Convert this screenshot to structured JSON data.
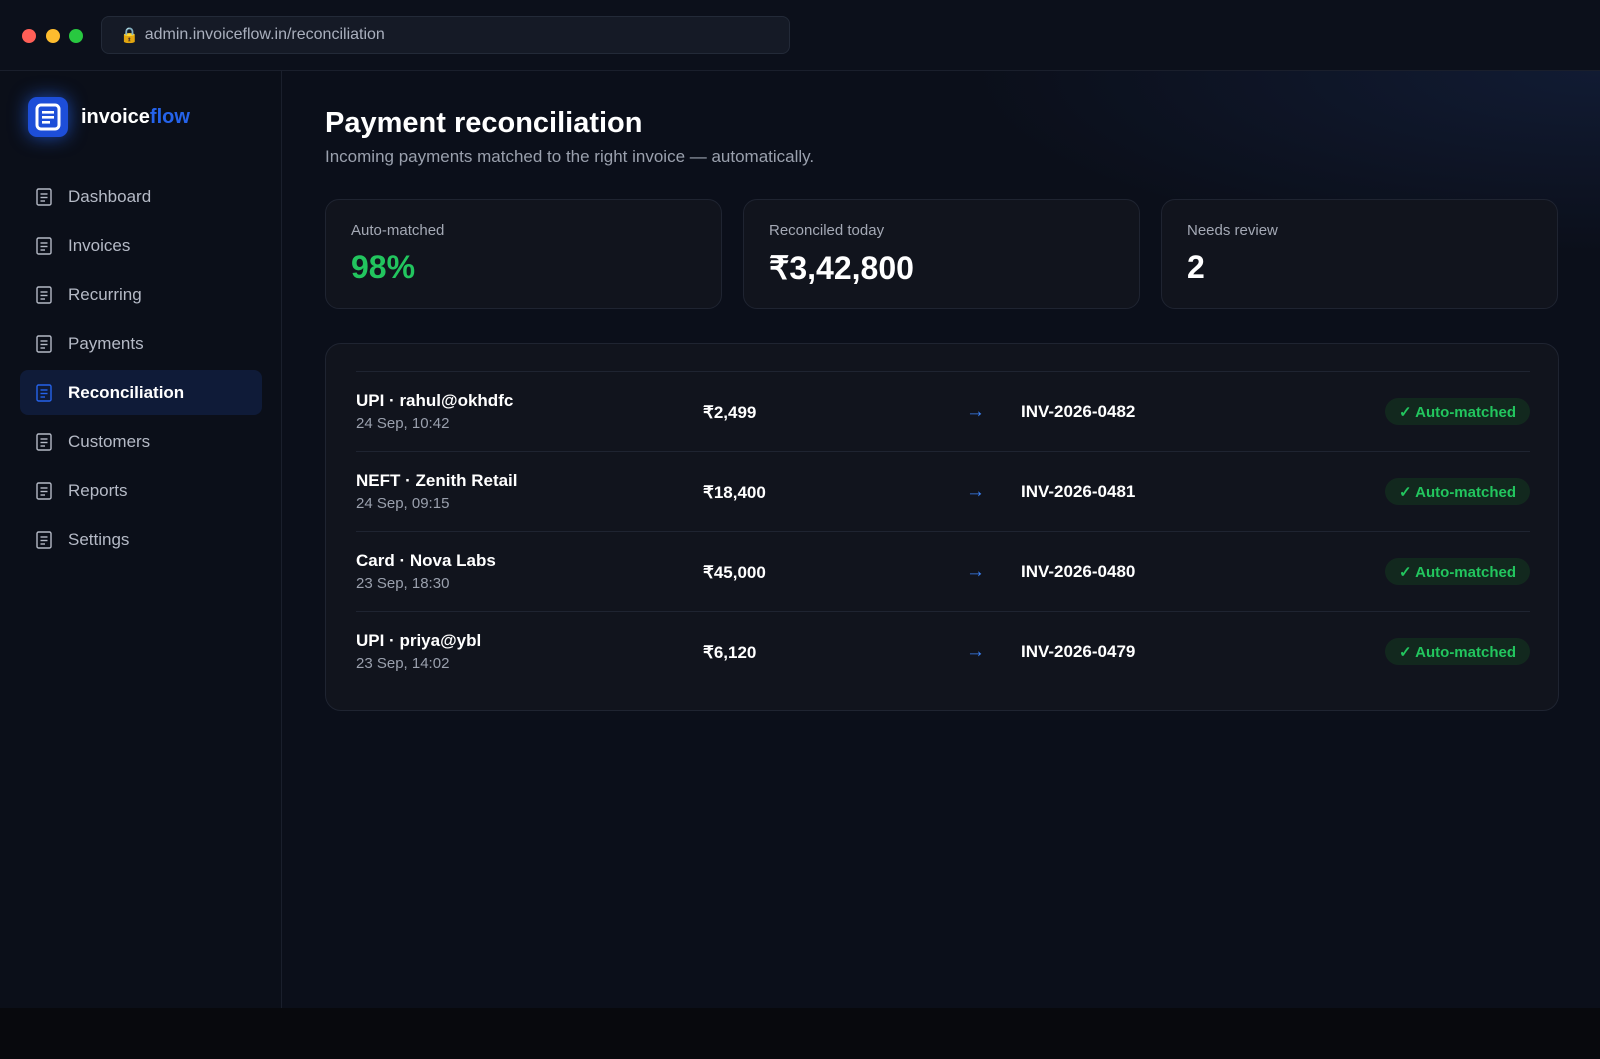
{
  "browser": {
    "url": "admin.invoiceflow.in/reconciliation",
    "lock_icon": "lock-icon"
  },
  "brand": {
    "name_primary": "invoice",
    "name_accent": "flow",
    "accent_color": "#2563eb"
  },
  "sidebar": {
    "items": [
      {
        "label": "Dashboard",
        "icon": "document-icon",
        "active": false
      },
      {
        "label": "Invoices",
        "icon": "document-icon",
        "active": false
      },
      {
        "label": "Recurring",
        "icon": "document-icon",
        "active": false
      },
      {
        "label": "Payments",
        "icon": "document-icon",
        "active": false
      },
      {
        "label": "Reconciliation",
        "icon": "document-icon",
        "active": true
      },
      {
        "label": "Customers",
        "icon": "document-icon",
        "active": false
      },
      {
        "label": "Reports",
        "icon": "document-icon",
        "active": false
      },
      {
        "label": "Settings",
        "icon": "document-icon",
        "active": false
      }
    ]
  },
  "page": {
    "title": "Payment reconciliation",
    "subtitle": "Incoming payments matched to the right invoice — automatically."
  },
  "stats": [
    {
      "label": "Auto-matched",
      "value": "98%",
      "color": "#22c55e"
    },
    {
      "label": "Reconciled today",
      "value": "₹3,42,800"
    },
    {
      "label": "Needs review",
      "value": "2"
    }
  ],
  "payments": [
    {
      "source": "UPI · rahul@okhdfc",
      "time": "24 Sep, 10:42",
      "amount": "₹2,499",
      "arrow": "→",
      "invoice": "INV-2026-0482",
      "status": "✓ Auto-matched"
    },
    {
      "source": "NEFT · Zenith Retail",
      "time": "24 Sep, 09:15",
      "amount": "₹18,400",
      "arrow": "→",
      "invoice": "INV-2026-0481",
      "status": "✓ Auto-matched"
    },
    {
      "source": "Card · Nova Labs",
      "time": "23 Sep, 18:30",
      "amount": "₹45,000",
      "arrow": "→",
      "invoice": "INV-2026-0480",
      "status": "✓ Auto-matched"
    },
    {
      "source": "UPI · priya@ybl",
      "time": "23 Sep, 14:02",
      "amount": "₹6,120",
      "arrow": "→",
      "invoice": "INV-2026-0479",
      "status": "✓ Auto-matched"
    }
  ],
  "colors": {
    "success": "#22c55e",
    "brand": "#2563eb",
    "background": "#0b0f1a"
  }
}
